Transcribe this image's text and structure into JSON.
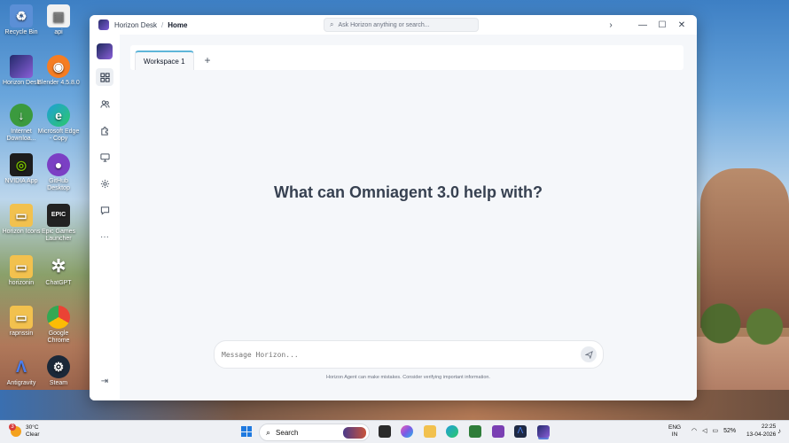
{
  "desktop": {
    "icons": [
      {
        "label": "Recycle Bin"
      },
      {
        "label": "api"
      },
      {
        "label": "Horizon Desk"
      },
      {
        "label": "Blender 4.5.8.0"
      },
      {
        "label": "Internet Downloa..."
      },
      {
        "label": "Microsoft Edge - Copy"
      },
      {
        "label": "NVIDIA App"
      },
      {
        "label": "GitHub Desktop"
      },
      {
        "label": "Horizon Icons"
      },
      {
        "label": "Epic Games Launcher"
      },
      {
        "label": "horizonin"
      },
      {
        "label": "ChatGPT"
      },
      {
        "label": "rapnssin"
      },
      {
        "label": "Google Chrome"
      },
      {
        "label": "Antigravity"
      },
      {
        "label": "Steam"
      }
    ]
  },
  "window": {
    "app_name": "Horizon Desk",
    "breadcrumb_sep": "/",
    "breadcrumb_current": "Home",
    "search_placeholder": "Ask Horizon anything or search...",
    "controls": {
      "forward": "›",
      "minimize": "—",
      "maximize": "☐",
      "close": "✕"
    }
  },
  "sidebar": {
    "items": [
      "dashboard",
      "people",
      "extensions",
      "monitor",
      "settings",
      "chat",
      "more"
    ],
    "more_glyph": "···",
    "logout_glyph": "⇥"
  },
  "main": {
    "tabs": [
      {
        "label": "Workspace 1"
      }
    ],
    "add_tab": "+",
    "hero_title": "What can Omniagent 3.0 help with?",
    "composer_placeholder": "Message Horizon...",
    "disclaimer": "Horizon Agent can make mistakes. Consider verifying important information."
  },
  "taskbar": {
    "weather_temp": "30°C",
    "weather_desc": "Clear",
    "weather_badge": "3",
    "search_label": "Search",
    "lang_1": "ENG",
    "lang_2": "IN",
    "battery": "52%",
    "time": "22:25",
    "date": "13-04-2026"
  }
}
